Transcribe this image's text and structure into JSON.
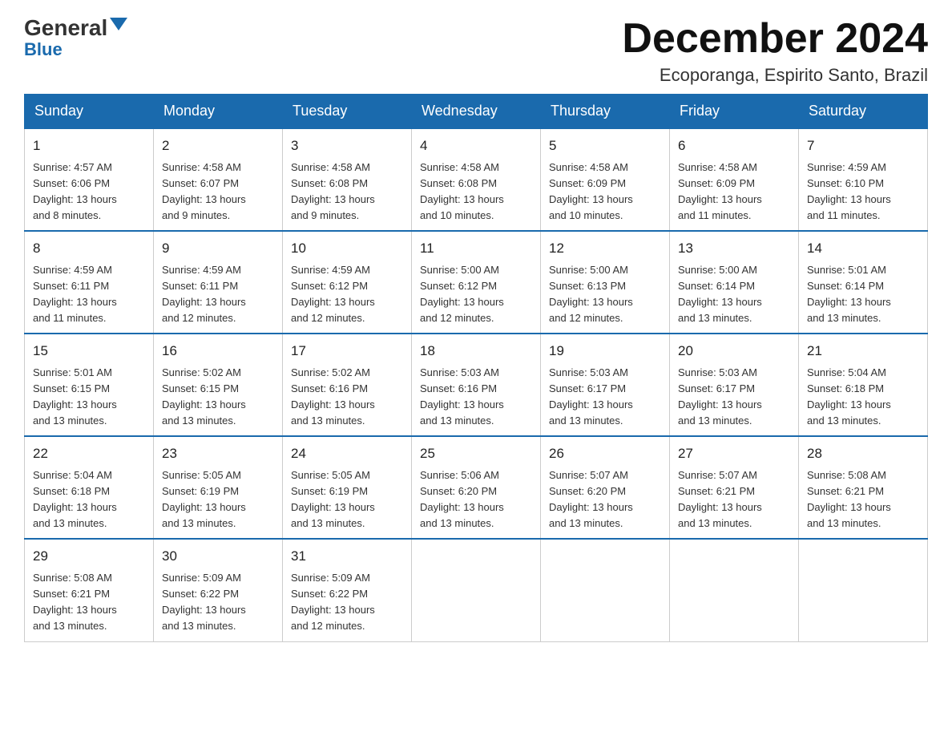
{
  "header": {
    "logo": {
      "general": "General",
      "blue": "Blue",
      "arrow": "▼"
    },
    "title": "December 2024",
    "location": "Ecoporanga, Espirito Santo, Brazil"
  },
  "calendar": {
    "days_of_week": [
      "Sunday",
      "Monday",
      "Tuesday",
      "Wednesday",
      "Thursday",
      "Friday",
      "Saturday"
    ],
    "weeks": [
      [
        {
          "day": "1",
          "sunrise": "4:57 AM",
          "sunset": "6:06 PM",
          "daylight": "13 hours and 8 minutes."
        },
        {
          "day": "2",
          "sunrise": "4:58 AM",
          "sunset": "6:07 PM",
          "daylight": "13 hours and 9 minutes."
        },
        {
          "day": "3",
          "sunrise": "4:58 AM",
          "sunset": "6:08 PM",
          "daylight": "13 hours and 9 minutes."
        },
        {
          "day": "4",
          "sunrise": "4:58 AM",
          "sunset": "6:08 PM",
          "daylight": "13 hours and 10 minutes."
        },
        {
          "day": "5",
          "sunrise": "4:58 AM",
          "sunset": "6:09 PM",
          "daylight": "13 hours and 10 minutes."
        },
        {
          "day": "6",
          "sunrise": "4:58 AM",
          "sunset": "6:09 PM",
          "daylight": "13 hours and 11 minutes."
        },
        {
          "day": "7",
          "sunrise": "4:59 AM",
          "sunset": "6:10 PM",
          "daylight": "13 hours and 11 minutes."
        }
      ],
      [
        {
          "day": "8",
          "sunrise": "4:59 AM",
          "sunset": "6:11 PM",
          "daylight": "13 hours and 11 minutes."
        },
        {
          "day": "9",
          "sunrise": "4:59 AM",
          "sunset": "6:11 PM",
          "daylight": "13 hours and 12 minutes."
        },
        {
          "day": "10",
          "sunrise": "4:59 AM",
          "sunset": "6:12 PM",
          "daylight": "13 hours and 12 minutes."
        },
        {
          "day": "11",
          "sunrise": "5:00 AM",
          "sunset": "6:12 PM",
          "daylight": "13 hours and 12 minutes."
        },
        {
          "day": "12",
          "sunrise": "5:00 AM",
          "sunset": "6:13 PM",
          "daylight": "13 hours and 12 minutes."
        },
        {
          "day": "13",
          "sunrise": "5:00 AM",
          "sunset": "6:14 PM",
          "daylight": "13 hours and 13 minutes."
        },
        {
          "day": "14",
          "sunrise": "5:01 AM",
          "sunset": "6:14 PM",
          "daylight": "13 hours and 13 minutes."
        }
      ],
      [
        {
          "day": "15",
          "sunrise": "5:01 AM",
          "sunset": "6:15 PM",
          "daylight": "13 hours and 13 minutes."
        },
        {
          "day": "16",
          "sunrise": "5:02 AM",
          "sunset": "6:15 PM",
          "daylight": "13 hours and 13 minutes."
        },
        {
          "day": "17",
          "sunrise": "5:02 AM",
          "sunset": "6:16 PM",
          "daylight": "13 hours and 13 minutes."
        },
        {
          "day": "18",
          "sunrise": "5:03 AM",
          "sunset": "6:16 PM",
          "daylight": "13 hours and 13 minutes."
        },
        {
          "day": "19",
          "sunrise": "5:03 AM",
          "sunset": "6:17 PM",
          "daylight": "13 hours and 13 minutes."
        },
        {
          "day": "20",
          "sunrise": "5:03 AM",
          "sunset": "6:17 PM",
          "daylight": "13 hours and 13 minutes."
        },
        {
          "day": "21",
          "sunrise": "5:04 AM",
          "sunset": "6:18 PM",
          "daylight": "13 hours and 13 minutes."
        }
      ],
      [
        {
          "day": "22",
          "sunrise": "5:04 AM",
          "sunset": "6:18 PM",
          "daylight": "13 hours and 13 minutes."
        },
        {
          "day": "23",
          "sunrise": "5:05 AM",
          "sunset": "6:19 PM",
          "daylight": "13 hours and 13 minutes."
        },
        {
          "day": "24",
          "sunrise": "5:05 AM",
          "sunset": "6:19 PM",
          "daylight": "13 hours and 13 minutes."
        },
        {
          "day": "25",
          "sunrise": "5:06 AM",
          "sunset": "6:20 PM",
          "daylight": "13 hours and 13 minutes."
        },
        {
          "day": "26",
          "sunrise": "5:07 AM",
          "sunset": "6:20 PM",
          "daylight": "13 hours and 13 minutes."
        },
        {
          "day": "27",
          "sunrise": "5:07 AM",
          "sunset": "6:21 PM",
          "daylight": "13 hours and 13 minutes."
        },
        {
          "day": "28",
          "sunrise": "5:08 AM",
          "sunset": "6:21 PM",
          "daylight": "13 hours and 13 minutes."
        }
      ],
      [
        {
          "day": "29",
          "sunrise": "5:08 AM",
          "sunset": "6:21 PM",
          "daylight": "13 hours and 13 minutes."
        },
        {
          "day": "30",
          "sunrise": "5:09 AM",
          "sunset": "6:22 PM",
          "daylight": "13 hours and 13 minutes."
        },
        {
          "day": "31",
          "sunrise": "5:09 AM",
          "sunset": "6:22 PM",
          "daylight": "13 hours and 12 minutes."
        },
        null,
        null,
        null,
        null
      ]
    ],
    "labels": {
      "sunrise": "Sunrise:",
      "sunset": "Sunset:",
      "daylight": "Daylight:"
    }
  }
}
